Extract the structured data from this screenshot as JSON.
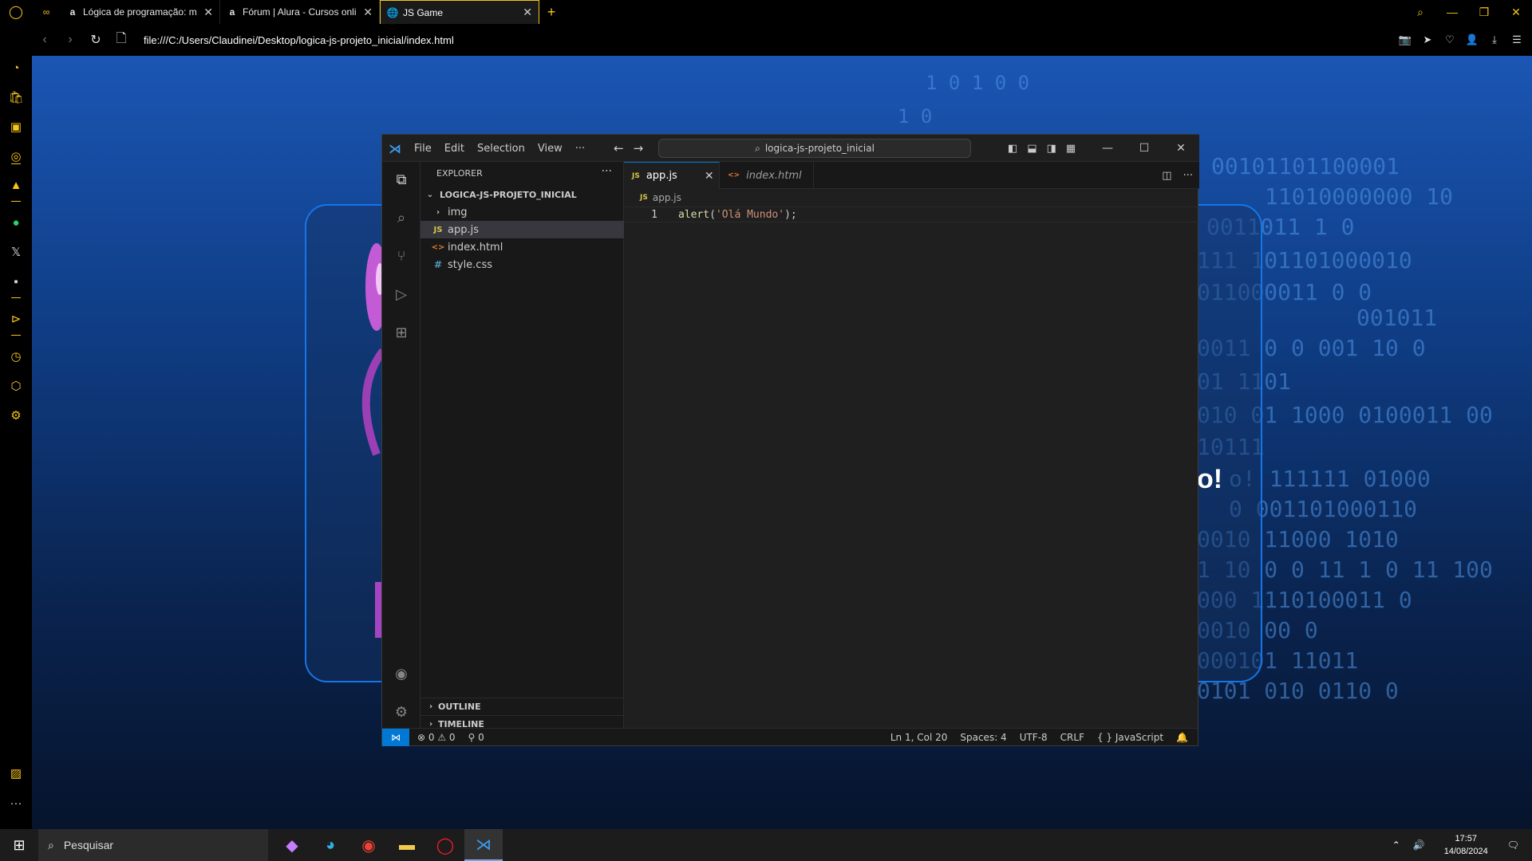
{
  "browser": {
    "tabs": [
      {
        "label": "Lógica de programação: m",
        "favicon": "a",
        "active": false
      },
      {
        "label": "Fórum | Alura - Cursos onli",
        "favicon": "a",
        "active": false
      },
      {
        "label": "JS Game",
        "favicon": "globe",
        "active": true
      }
    ],
    "new_tab": "+",
    "url": "file:///C:/Users/Claudinei/Desktop/logica-js-projeto_inicial/index.html"
  },
  "page": {
    "heading_fragment": "o!",
    "binary_rows": [
      "1  0  1 0  0",
      "1         0",
      "00101101100001",
      "11010000000 10",
      "0011011 1 0",
      "111 101101000010",
      "011000011 0 0",
      "001011",
      "0011  0  0  001 10 0",
      "01  1101",
      "010 01 1000  0100011 00",
      "10111",
      "o! 111111 01000",
      "0 001101000110",
      "0010 11000 1010",
      "1 10 0 0 11 1 0 11 100",
      "000 1110100011 0",
      "0010 00   0",
      "000101 11011",
      "0101 010 0110 0"
    ]
  },
  "vscode": {
    "menu": [
      "File",
      "Edit",
      "Selection",
      "View",
      "···"
    ],
    "search": "logica-js-projeto_inicial",
    "explorer": {
      "title": "EXPLORER",
      "root": "LOGICA-JS-PROJETO_INICIAL",
      "items": [
        {
          "name": "img",
          "type": "folder"
        },
        {
          "name": "app.js",
          "type": "js"
        },
        {
          "name": "index.html",
          "type": "html"
        },
        {
          "name": "style.css",
          "type": "css"
        }
      ],
      "outline": "OUTLINE",
      "timeline": "TIMELINE"
    },
    "tabs": [
      {
        "label": "app.js",
        "icon": "JS"
      },
      {
        "label": "index.html",
        "icon": "<>"
      }
    ],
    "breadcrumb": "app.js",
    "code": {
      "line_number": "1",
      "fn": "alert",
      "open": "(",
      "str": "'Olá Mundo'",
      "close": ");"
    },
    "status": {
      "errors": "0",
      "warnings": "0",
      "ports": "0",
      "position": "Ln 1, Col 20",
      "spaces": "Spaces: 4",
      "encoding": "UTF-8",
      "eol": "CRLF",
      "language": "JavaScript"
    }
  },
  "taskbar": {
    "search_placeholder": "Pesquisar",
    "time": "17:57",
    "date": "14/08/2024"
  },
  "colors": {
    "opera_accent": "#f5c518",
    "vscode_blue": "#0078d4",
    "page_blue": "#1b56b4"
  }
}
